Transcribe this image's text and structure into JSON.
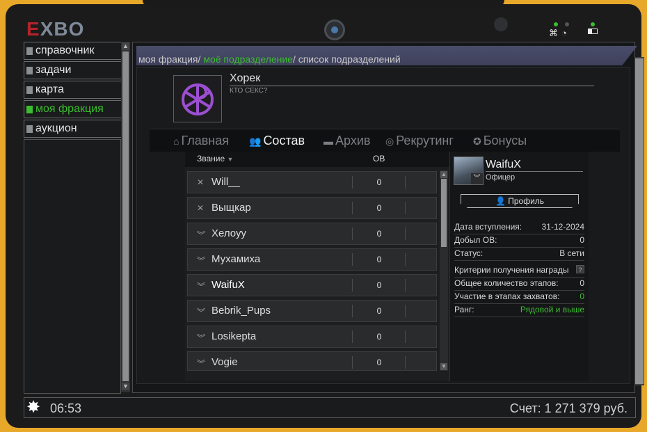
{
  "logo": {
    "red": "E",
    "rest": "XBO"
  },
  "menu": [
    {
      "label": "справочник",
      "active": false
    },
    {
      "label": "задачи",
      "active": false
    },
    {
      "label": "карта",
      "active": false
    },
    {
      "label": "моя фракция",
      "active": true
    },
    {
      "label": "аукцион",
      "active": false
    }
  ],
  "breadcrumb": {
    "part1": "моя фракция",
    "sep1": "/",
    "part2": "моё подразделение",
    "sep2": "/",
    "part3": "список подразделений"
  },
  "faction": {
    "name": "Хорек",
    "motto": "КТО СЕКС?"
  },
  "tabs": [
    {
      "label": "Главная",
      "icon": "home-icon",
      "glyph": "⌂",
      "active": false
    },
    {
      "label": "Состав",
      "icon": "users-icon",
      "glyph": "👥",
      "active": true
    },
    {
      "label": "Архив",
      "icon": "folder-icon",
      "glyph": "▬",
      "active": false
    },
    {
      "label": "Рекрутинг",
      "icon": "search-person-icon",
      "glyph": "◎",
      "active": false
    },
    {
      "label": "Бонусы",
      "icon": "star-icon",
      "glyph": "✪",
      "active": false
    }
  ],
  "list": {
    "header_rank": "Звание",
    "header_ob": "ОВ",
    "rows": [
      {
        "name": "Will__",
        "ob": "0",
        "rank_glyph": "✕"
      },
      {
        "name": "Выщкар",
        "ob": "0",
        "rank_glyph": "✕"
      },
      {
        "name": "Хелоуу",
        "ob": "0",
        "rank_glyph": "︾"
      },
      {
        "name": "Мухамиха",
        "ob": "0",
        "rank_glyph": "︾"
      },
      {
        "name": "WaifuX",
        "ob": "0",
        "rank_glyph": "︾"
      },
      {
        "name": "Bebrik_Pups",
        "ob": "0",
        "rank_glyph": "︾"
      },
      {
        "name": "Losikepta",
        "ob": "0",
        "rank_glyph": "︾"
      },
      {
        "name": "Vogie",
        "ob": "0",
        "rank_glyph": "︾"
      }
    ]
  },
  "profile": {
    "name": "WaifuX",
    "role": "Офицер",
    "button": "Профиль",
    "join_label": "Дата вступления:",
    "join_value": "31-12-2024",
    "ob_label": "Добыл ОВ:",
    "ob_value": "0",
    "status_label": "Статус:",
    "status_value": "В сети",
    "criteria_label": "Критерии получения награды",
    "criteria_q": "?",
    "stages_label": "Общее количество этапов:",
    "stages_value": "0",
    "capture_label": "Участие в этапах захватов:",
    "capture_value": "0",
    "rank_label": "Ранг:",
    "rank_value": "Рядовой и выше"
  },
  "bottom": {
    "time": "06:53",
    "money": "Счет: 1 271 379 руб."
  },
  "colors": {
    "accent_green": "#3bbd2f",
    "frame_yellow": "#e8a82a",
    "logo_red": "#b4232b"
  }
}
